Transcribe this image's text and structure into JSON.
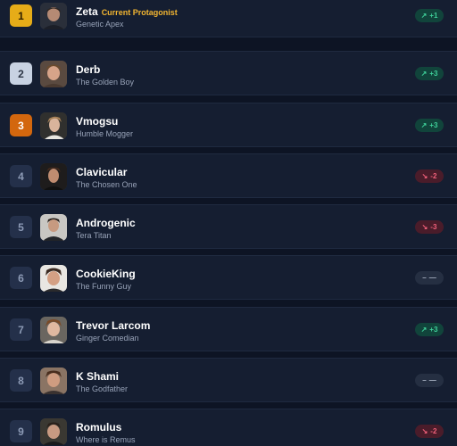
{
  "leaderboard": {
    "entries": [
      {
        "rank": "1",
        "name": "Zeta",
        "tag": "Current Protagonist",
        "title": "Genetic Apex",
        "trend": "up",
        "change": "+1",
        "trend_icon": "trend-up-icon"
      },
      {
        "rank": "2",
        "name": "Derb",
        "tag": "",
        "title": "The Golden Boy",
        "trend": "up",
        "change": "+3",
        "trend_icon": "trend-up-icon"
      },
      {
        "rank": "3",
        "name": "Vmogsu",
        "tag": "",
        "title": "Humble Mogger",
        "trend": "up",
        "change": "+3",
        "trend_icon": "trend-up-icon"
      },
      {
        "rank": "4",
        "name": "Clavicular",
        "tag": "",
        "title": "The Chosen One",
        "trend": "down",
        "change": "-2",
        "trend_icon": "trend-down-icon"
      },
      {
        "rank": "5",
        "name": "Androgenic",
        "tag": "",
        "title": "Tera Titan",
        "trend": "down",
        "change": "-3",
        "trend_icon": "trend-down-icon"
      },
      {
        "rank": "6",
        "name": "CookieKing",
        "tag": "",
        "title": "The Funny Guy",
        "trend": "same",
        "change": "—",
        "trend_icon": "dash-icon"
      },
      {
        "rank": "7",
        "name": "Trevor Larcom",
        "tag": "",
        "title": "Ginger Comedian",
        "trend": "up",
        "change": "+3",
        "trend_icon": "trend-up-icon"
      },
      {
        "rank": "8",
        "name": "K Shami",
        "tag": "",
        "title": "The Godfather",
        "trend": "same",
        "change": "—",
        "trend_icon": "dash-icon"
      },
      {
        "rank": "9",
        "name": "Romulus",
        "tag": "",
        "title": "Where is Remus",
        "trend": "down",
        "change": "-2",
        "trend_icon": "trend-down-icon"
      }
    ]
  },
  "colors": {
    "gold": "#e6ac18",
    "silver": "#c8d2e2",
    "bronze": "#d3670e",
    "up": "#3fd19a",
    "down": "#f0607a",
    "tag": "#f2b531"
  }
}
